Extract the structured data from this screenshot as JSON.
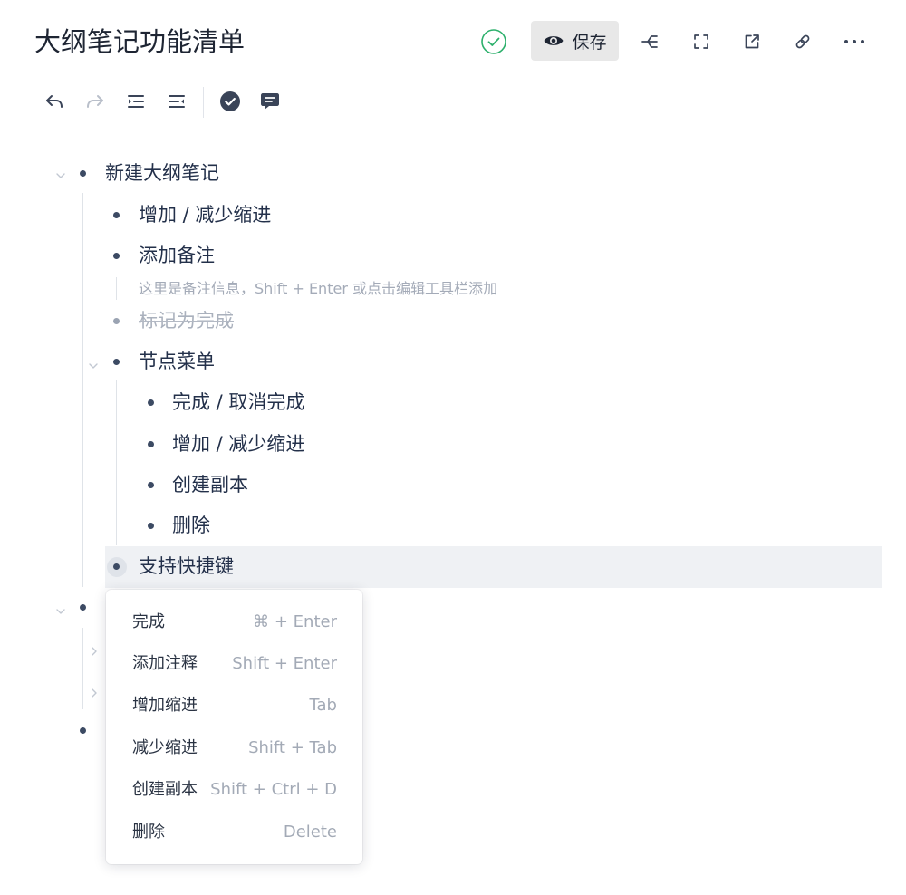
{
  "header": {
    "title": "大纲笔记功能清单",
    "save_label": "保存"
  },
  "outline": {
    "root": "新建大纲笔记",
    "items": [
      "增加 / 减少缩进",
      "添加备注",
      "标记为完成",
      "节点菜单",
      "支持快捷键"
    ],
    "note": "这里是备注信息，Shift + Enter 或点击编辑工具栏添加",
    "submenu_items": [
      "完成 / 取消完成",
      "增加 / 减少缩进",
      "创建副本",
      "删除"
    ]
  },
  "context_menu": {
    "items": [
      {
        "label": "完成",
        "shortcut": "⌘ + Enter"
      },
      {
        "label": "添加注释",
        "shortcut": "Shift + Enter"
      },
      {
        "label": "增加缩进",
        "shortcut": "Tab"
      },
      {
        "label": "减少缩进",
        "shortcut": "Shift + Tab"
      },
      {
        "label": "创建副本",
        "shortcut": "Shift + Ctrl + D"
      },
      {
        "label": "删除",
        "shortcut": "Delete"
      }
    ]
  },
  "colors": {
    "accent_green": "#2db06c",
    "text": "#23304a",
    "muted": "#a4abb8"
  },
  "icons": {
    "toolbar": [
      "undo-icon",
      "redo-icon",
      "indent-icon",
      "outdent-icon",
      "complete-icon",
      "comment-icon"
    ],
    "header": [
      "saved-check-icon",
      "eye-icon",
      "mindmap-icon",
      "fullscreen-icon",
      "open-external-icon",
      "link-icon",
      "more-icon"
    ]
  }
}
